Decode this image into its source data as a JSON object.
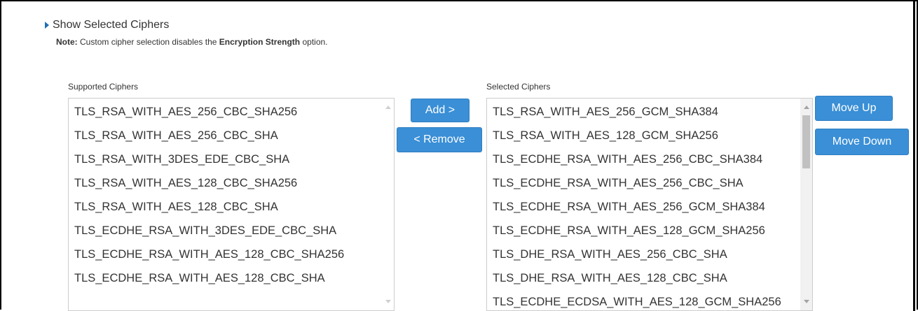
{
  "toggle_label": "Show Selected Ciphers",
  "note": {
    "prefix": "Note:",
    "text": "Custom cipher selection disables the",
    "emphasis": "Encryption Strength",
    "suffix": "option."
  },
  "supported": {
    "label": "Supported Ciphers",
    "items": [
      "TLS_RSA_WITH_AES_256_CBC_SHA256",
      "TLS_RSA_WITH_AES_256_CBC_SHA",
      "TLS_RSA_WITH_3DES_EDE_CBC_SHA",
      "TLS_RSA_WITH_AES_128_CBC_SHA256",
      "TLS_RSA_WITH_AES_128_CBC_SHA",
      "TLS_ECDHE_RSA_WITH_3DES_EDE_CBC_SHA",
      "TLS_ECDHE_RSA_WITH_AES_128_CBC_SHA256",
      "TLS_ECDHE_RSA_WITH_AES_128_CBC_SHA"
    ]
  },
  "selected": {
    "label": "Selected Ciphers",
    "items": [
      "TLS_RSA_WITH_AES_256_GCM_SHA384",
      "TLS_RSA_WITH_AES_128_GCM_SHA256",
      "TLS_ECDHE_RSA_WITH_AES_256_CBC_SHA384",
      "TLS_ECDHE_RSA_WITH_AES_256_CBC_SHA",
      "TLS_ECDHE_RSA_WITH_AES_256_GCM_SHA384",
      "TLS_ECDHE_RSA_WITH_AES_128_GCM_SHA256",
      "TLS_DHE_RSA_WITH_AES_256_CBC_SHA",
      "TLS_DHE_RSA_WITH_AES_128_CBC_SHA",
      "TLS_ECDHE_ECDSA_WITH_AES_128_GCM_SHA256"
    ]
  },
  "buttons": {
    "add": "Add >",
    "remove": "< Remove",
    "move_up": "Move Up",
    "move_down": "Move Down"
  },
  "colors": {
    "accent": "#3a8fd6",
    "toggle_arrow": "#1f6fb5"
  }
}
